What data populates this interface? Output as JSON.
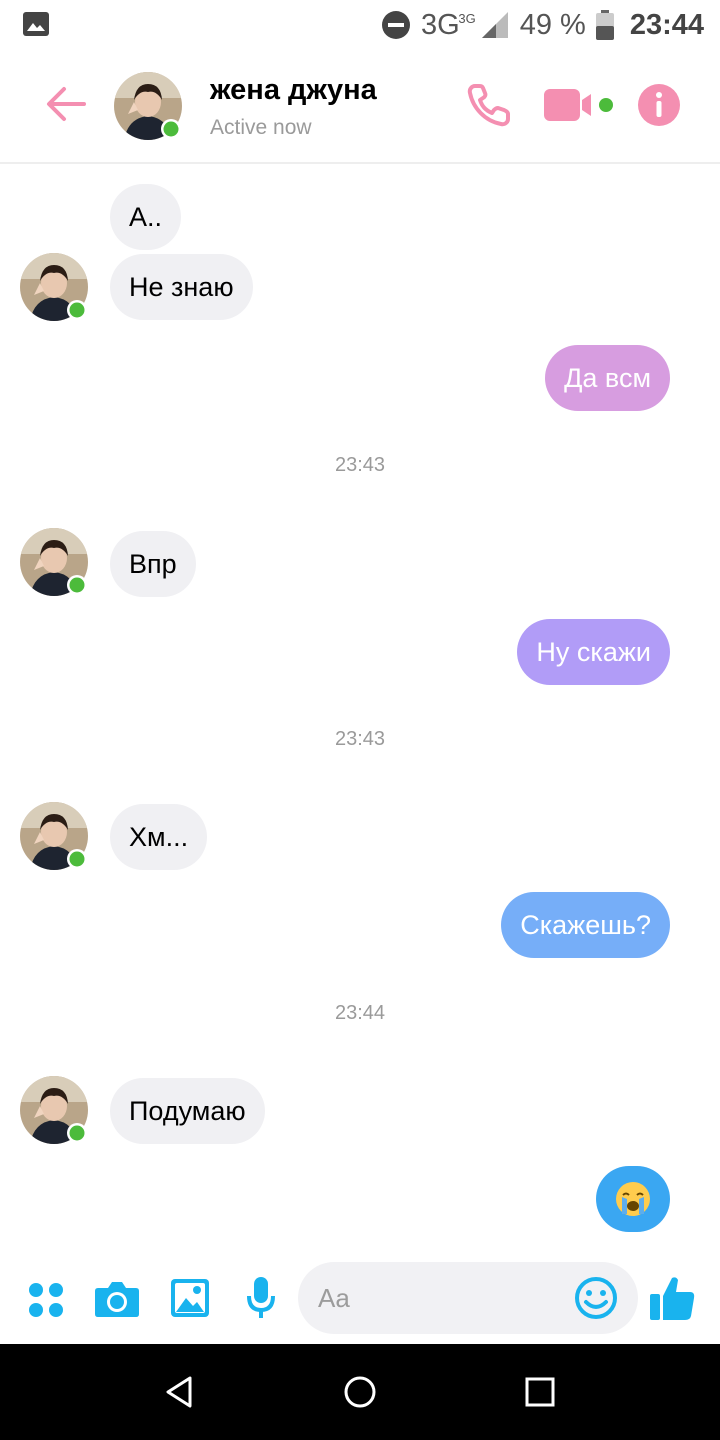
{
  "status_bar": {
    "network": "3G",
    "network_sup": "3G",
    "battery": "49 %",
    "time": "23:44"
  },
  "header": {
    "contact_name": "жена джуна",
    "status": "Active now"
  },
  "messages": {
    "m1": "А..",
    "m2": "Не знаю",
    "m3": "Да всм",
    "t1": "23:43",
    "m4": "Впр",
    "m5": "Ну скажи",
    "t2": "23:43",
    "m6": "Хм...",
    "m7": "Скажешь?",
    "t3": "23:44",
    "m8": "Подумаю",
    "m9_icon": "crying-face-emoji"
  },
  "composer": {
    "placeholder": "Aa"
  },
  "colors": {
    "accent_header": "#f48fb1",
    "composer_blue": "#19b3ee",
    "bubble_pink_purple": "#d79de0",
    "bubble_purple": "#b19cf7",
    "bubble_blue": "#76aef8",
    "incoming_bubble": "#f0f0f3",
    "online_dot": "#4cbb3b"
  }
}
